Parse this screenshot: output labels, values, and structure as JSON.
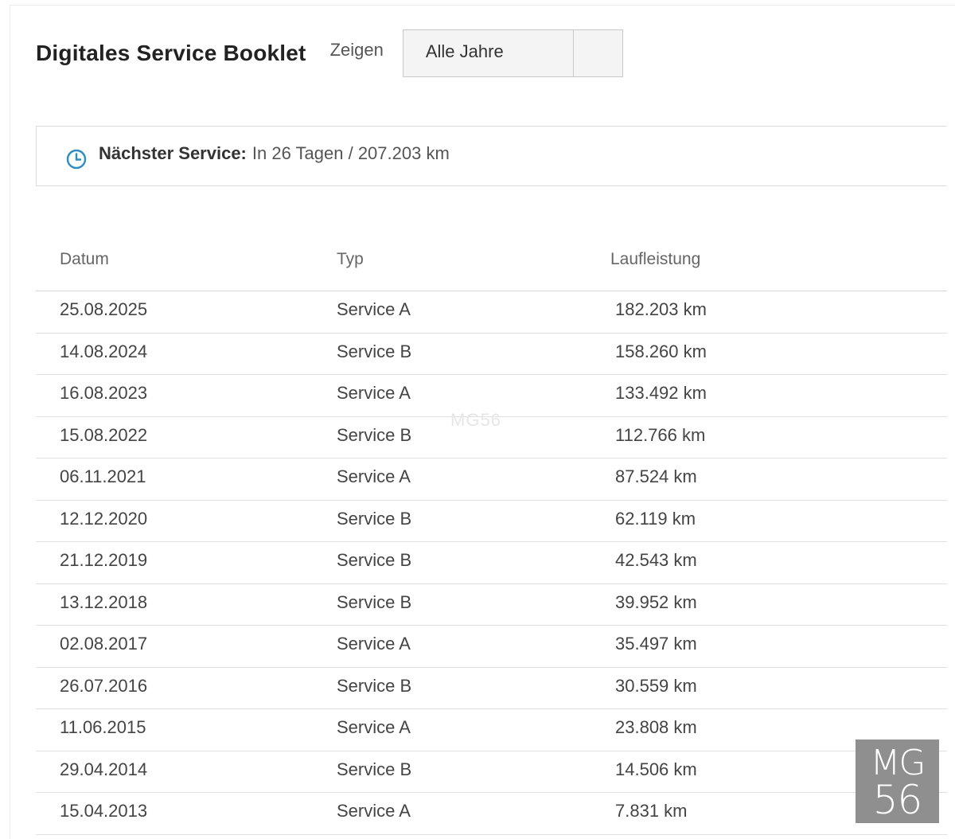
{
  "header": {
    "title": "Digitales Service Booklet",
    "filter_label": "Zeigen",
    "filter_value": "Alle Jahre"
  },
  "next_service": {
    "label": "Nächster Service:",
    "value": "In 26 Tagen / 207.203 km",
    "icon": "clock-icon",
    "icon_color": "#2a8fc0"
  },
  "table": {
    "columns": [
      "Datum",
      "Typ",
      "Laufleistung"
    ],
    "rows": [
      {
        "date": "25.08.2025",
        "type": "Service A",
        "mileage": "182.203 km"
      },
      {
        "date": "14.08.2024",
        "type": "Service B",
        "mileage": "158.260 km"
      },
      {
        "date": "16.08.2023",
        "type": "Service A",
        "mileage": "133.492 km"
      },
      {
        "date": "15.08.2022",
        "type": "Service B",
        "mileage": "112.766 km"
      },
      {
        "date": "06.11.2021",
        "type": "Service A",
        "mileage": "87.524 km"
      },
      {
        "date": "12.12.2020",
        "type": "Service B",
        "mileage": "62.119 km"
      },
      {
        "date": "21.12.2019",
        "type": "Service B",
        "mileage": "42.543 km"
      },
      {
        "date": "13.12.2018",
        "type": "Service B",
        "mileage": "39.952 km"
      },
      {
        "date": "02.08.2017",
        "type": "Service A",
        "mileage": "35.497 km"
      },
      {
        "date": "26.07.2016",
        "type": "Service B",
        "mileage": "30.559 km"
      },
      {
        "date": "11.06.2015",
        "type": "Service A",
        "mileage": "23.808 km"
      },
      {
        "date": "29.04.2014",
        "type": "Service B",
        "mileage": "14.506 km"
      },
      {
        "date": "15.04.2013",
        "type": "Service A",
        "mileage": "7.831 km"
      }
    ]
  },
  "watermark": {
    "center_text": "MG56",
    "logo_line1": "MG",
    "logo_line2": "56"
  }
}
